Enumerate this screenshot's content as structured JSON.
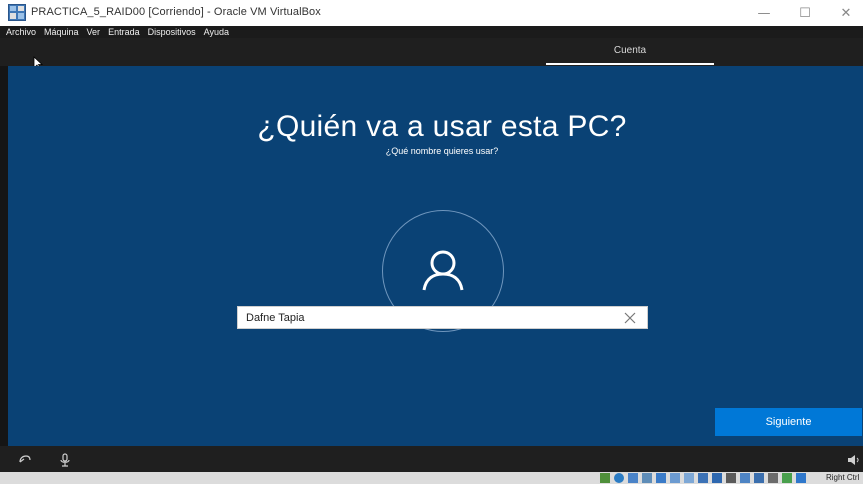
{
  "window": {
    "title": "PRACTICA_5_RAID00 [Corriendo] - Oracle VM VirtualBox",
    "minimize_glyph": "—",
    "maximize_glyph": "☐",
    "close_glyph": "✕"
  },
  "menu": {
    "items": [
      "Archivo",
      "Máquina",
      "Ver",
      "Entrada",
      "Dispositivos",
      "Ayuda"
    ]
  },
  "oobe": {
    "section_label": "Cuenta",
    "heading": "¿Quién va a usar esta PC?",
    "subheading": "¿Qué nombre quieres usar?",
    "name_value": "Dafne Tapia",
    "next_label": "Siguiente"
  },
  "statusbar": {
    "host_key": "Right Ctrl"
  },
  "colors": {
    "oobe_blue": "#0a4275",
    "button_blue": "#0078d7",
    "dark_strip": "#1f1f1f"
  },
  "icons": {
    "app": "virtualbox-icon",
    "avatar": "user-icon",
    "clear": "close-icon",
    "ease_of_access": "ease-of-access-icon",
    "microphone": "microphone-icon",
    "volume": "speaker-icon"
  }
}
